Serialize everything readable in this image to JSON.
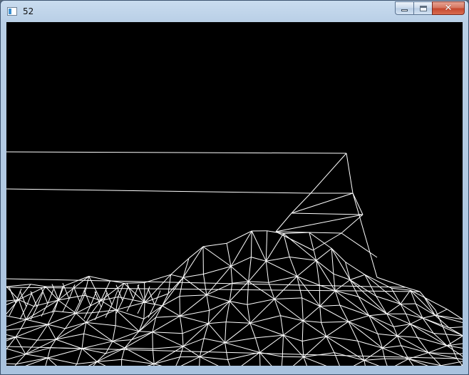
{
  "window": {
    "title": "52",
    "icons": {
      "app": "app-icon",
      "minimize": "minimize-icon",
      "maximize": "maximize-icon",
      "close": "close-icon"
    },
    "close_glyph": "✕"
  },
  "colors": {
    "viewport_background": "#000000",
    "wireframe_stroke": "#ffffff",
    "close_button": "#c4462d"
  }
}
